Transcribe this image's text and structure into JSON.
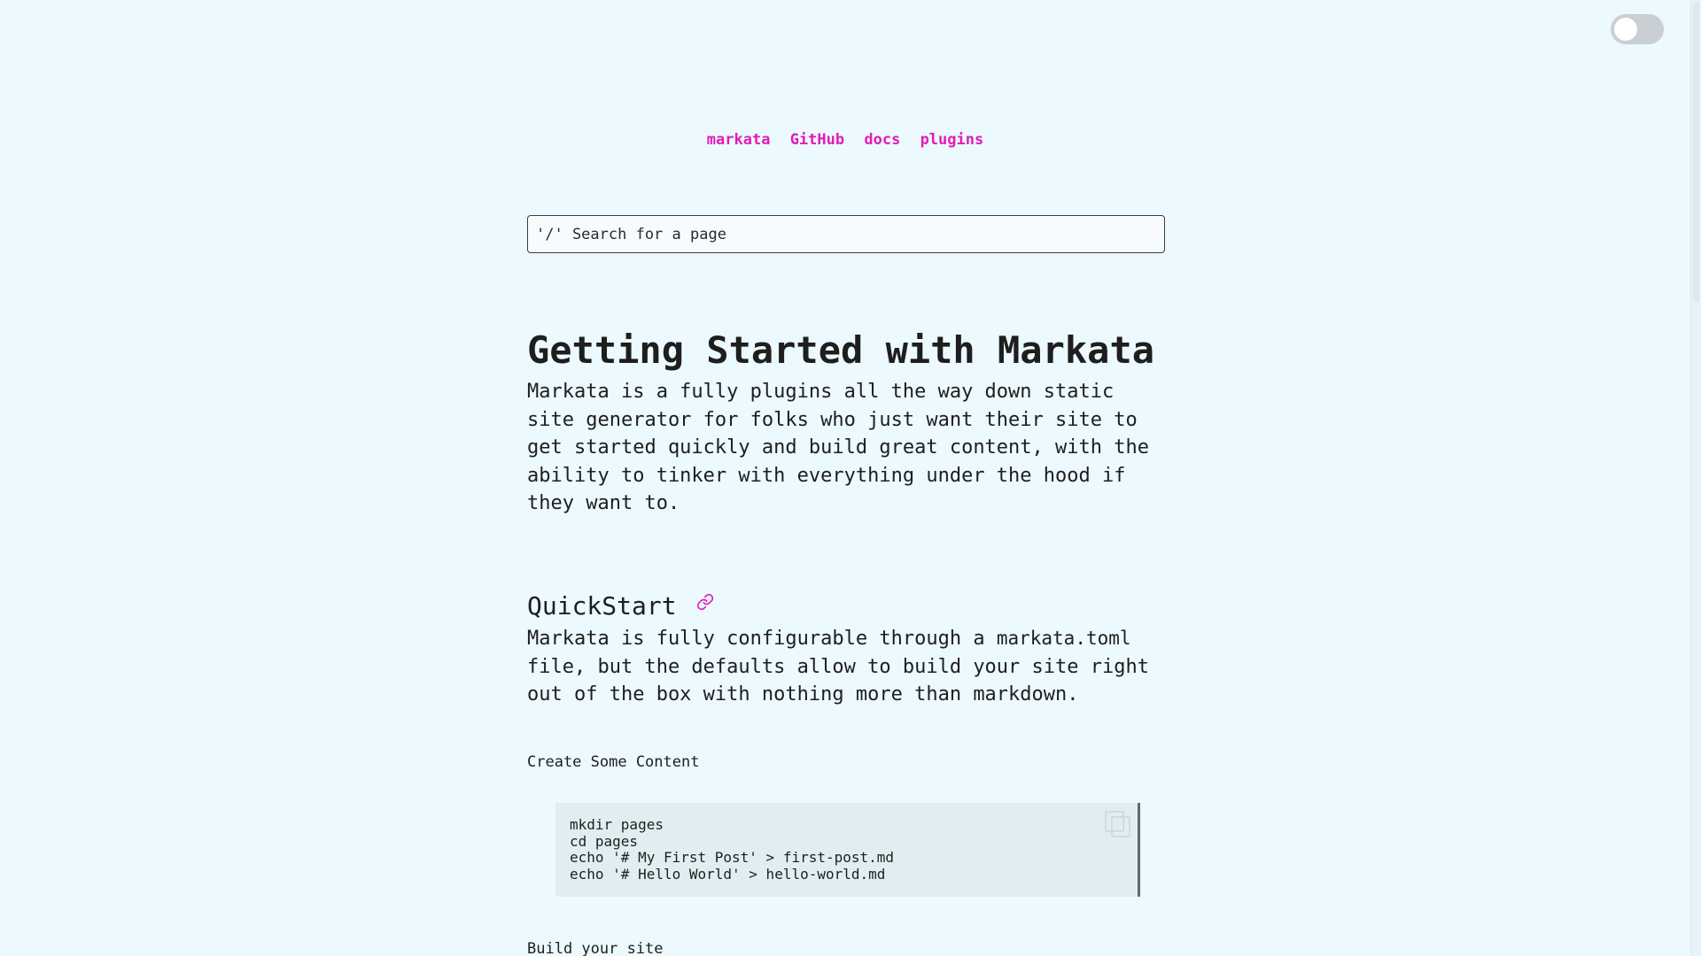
{
  "nav": {
    "links": [
      {
        "label": "markata"
      },
      {
        "label": "GitHub"
      },
      {
        "label": "docs"
      },
      {
        "label": "plugins"
      }
    ]
  },
  "search": {
    "placeholder": "'/' Search for a page"
  },
  "article": {
    "title": "Getting Started with Markata",
    "intro": "Markata is a fully plugins all the way down static site generator for folks who just want their site to get started quickly and build great content, with the ability to tinker with everything under the hood if they want to.",
    "quickstart": {
      "heading": "QuickStart",
      "text_before": "Markata is fully configurable through a ",
      "config_file": "markata.toml",
      "text_after": " file, but the defaults allow to build your site right out of the box with nothing more than markdown."
    },
    "steps": [
      {
        "label": "Create Some Content",
        "code": "mkdir pages\ncd pages\necho '# My First Post' > first-post.md\necho '# Hello World' > hello-world.md"
      },
      {
        "label": "Build your site"
      }
    ]
  },
  "icons": {
    "theme_toggle": "theme-toggle",
    "anchor": "link-icon",
    "copy": "copy-icon"
  },
  "colors": {
    "background": "#ecf9fe",
    "accent": "#e41bb7",
    "text": "#1e1e1e",
    "code_background": "#e1eef1"
  }
}
